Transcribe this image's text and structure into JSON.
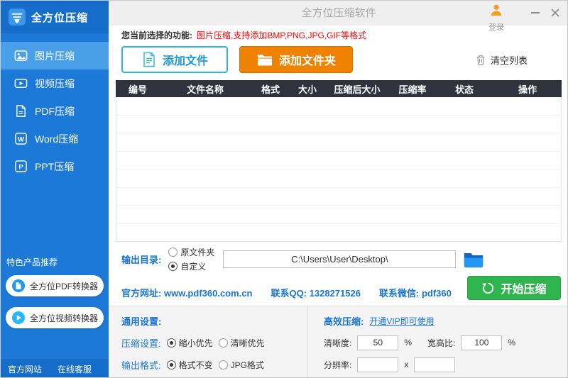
{
  "window": {
    "title": "全方位压缩软件",
    "login_label": "登录"
  },
  "sidebar": {
    "logo_text": "全方位压缩",
    "menu": [
      {
        "label": "图片压缩",
        "active": true
      },
      {
        "label": "视频压缩",
        "active": false
      },
      {
        "label": "PDF压缩",
        "active": false
      },
      {
        "label": "Word压缩",
        "active": false
      },
      {
        "label": "PPT压缩",
        "active": false
      }
    ],
    "featured_title": "特色产品推荐",
    "products": [
      {
        "label": "全方位PDF转换器"
      },
      {
        "label": "全方位视频转换器"
      }
    ],
    "footer_links": [
      "官方网站",
      "在线客服"
    ]
  },
  "notice": {
    "prefix": "您当前选择的功能:",
    "detail": "图片压缩,支持添加BMP,PNG,JPG,GIF等格式"
  },
  "toolbar": {
    "add_file": "添加文件",
    "add_folder": "添加文件夹",
    "clear_list": "清空列表"
  },
  "table": {
    "headers": [
      "编号",
      "文件名称",
      "格式",
      "大小",
      "压缩后大小",
      "压缩率",
      "状态",
      "操作"
    ],
    "rows": []
  },
  "output": {
    "label": "输出目录:",
    "radio_original": "原文件夹",
    "radio_custom": "自定义",
    "selected": "自定义",
    "path": "C:\\Users\\User\\Desktop\\"
  },
  "info": {
    "website_label": "官方网址:",
    "website": "www.pdf360.com.cn",
    "qq_label": "联系QQ:",
    "qq": "1328271526",
    "wechat_label": "联系微信:",
    "wechat": "pdf360",
    "start_button": "开始压缩"
  },
  "settings": {
    "general_title": "通用设置:",
    "compression_label": "压缩设置:",
    "compression_options": [
      "缩小优先",
      "清晰优先"
    ],
    "compression_selected": "缩小优先",
    "format_label": "输出格式:",
    "format_options": [
      "格式不变",
      "JPG格式"
    ],
    "format_selected": "格式不变",
    "efficient_label": "高效压缩:",
    "vip_link": "开通VIP即可使用",
    "clarity_label": "清晰度:",
    "clarity_value": "50",
    "percent": "%",
    "ratio_label": "宽高比:",
    "ratio_value": "100",
    "resolution_label": "分辨率:",
    "x_separator": "x"
  },
  "colors": {
    "sidebar_blue": "#1c79d8",
    "active_blue": "#4aa0e8",
    "accent_blue": "#1b75d0",
    "orange": "#ef8200",
    "green": "#2eb54e",
    "red": "#ff0000",
    "table_header": "#30333d"
  }
}
